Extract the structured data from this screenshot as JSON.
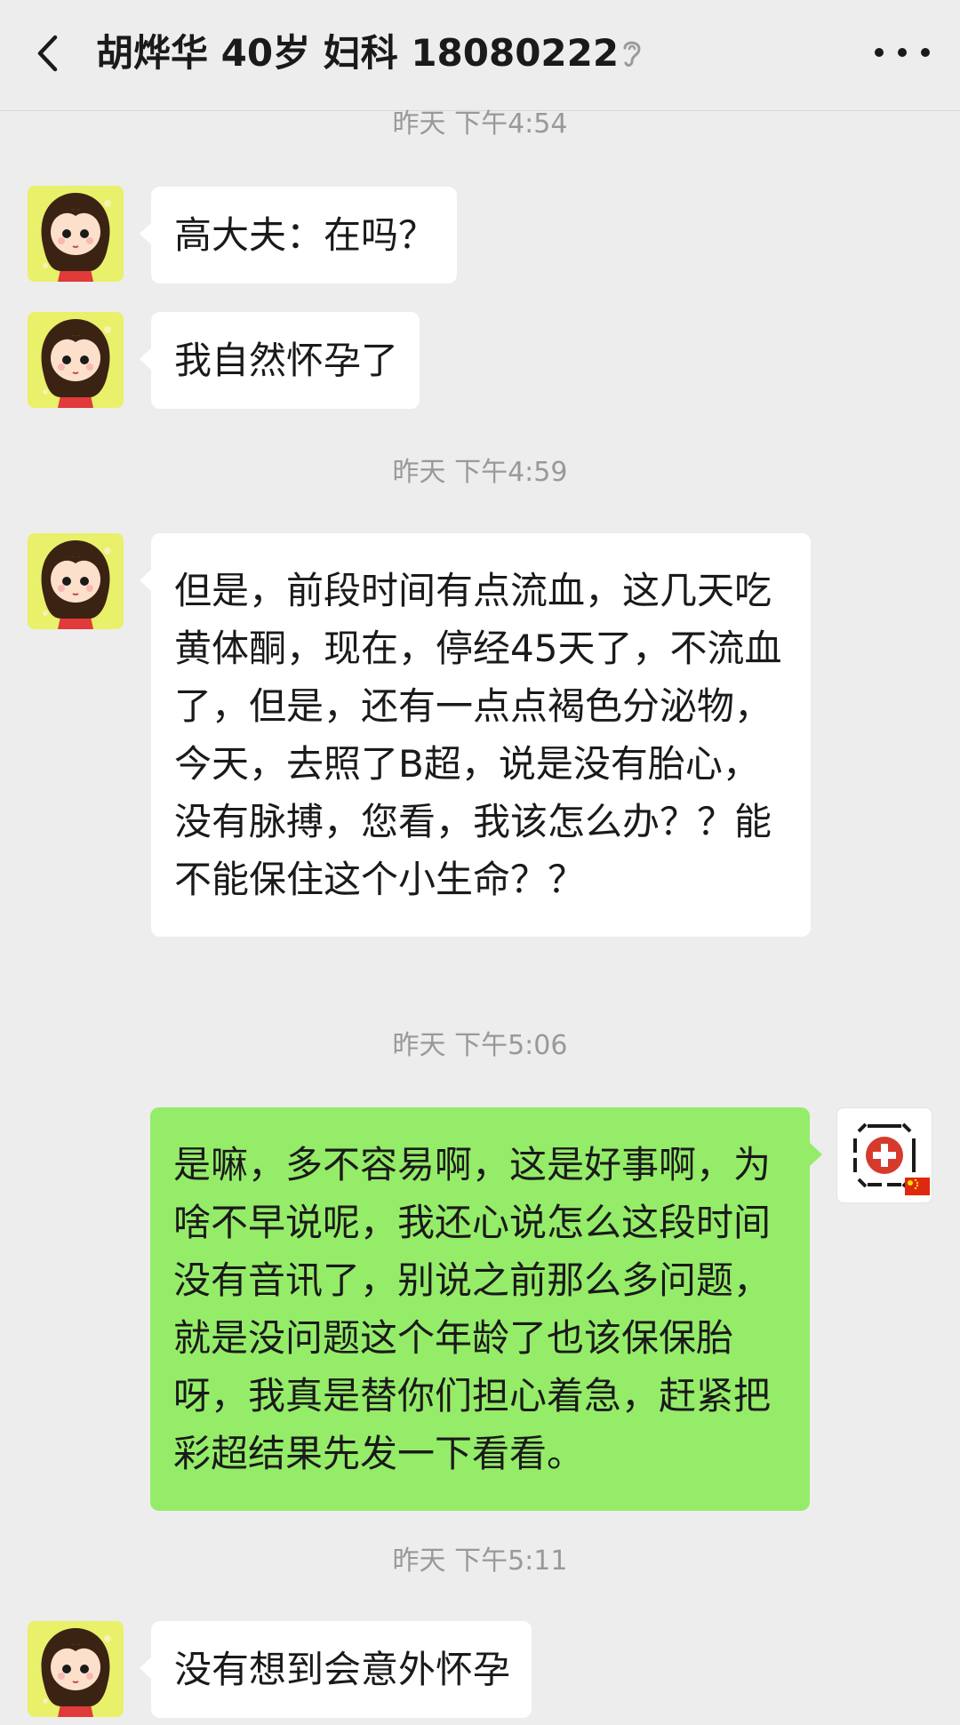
{
  "header": {
    "back_icon": "chevron-left-icon",
    "title": "胡烨华 40岁 妇科 18080222",
    "ear_icon": "ear-icon",
    "more_icon": "more-icon"
  },
  "timestamps": [
    "昨天 下午4:54",
    "昨天 下午4:59",
    "昨天 下午5:06",
    "昨天 下午5:11"
  ],
  "messages": [
    {
      "sender": "patient",
      "text": "高大夫：在吗？"
    },
    {
      "sender": "patient",
      "text": "我自然怀孕了"
    },
    {
      "sender": "patient",
      "text": "但是，前段时间有点流血，这几天吃黄体酮，现在，停经45天了，不流血了，但是，还有一点点褐色分泌物，今天，去照了B超，说是没有胎心，没有脉搏，您看，我该怎么办？？能不能保住这个小生命？？"
    },
    {
      "sender": "doctor",
      "text": "是嘛，多不容易啊，这是好事啊，为啥不早说呢，我还心说怎么这段时间没有音讯了，别说之前那么多问题，就是没问题这个年龄了也该保保胎呀，我真是替你们担心着急，赶紧把彩超结果先发一下看看。"
    },
    {
      "sender": "patient",
      "text": "没有想到会意外怀孕"
    }
  ],
  "colors": {
    "background": "#ededed",
    "incoming_bubble": "#ffffff",
    "outgoing_bubble": "#95ec69",
    "timestamp_text": "#999999"
  }
}
